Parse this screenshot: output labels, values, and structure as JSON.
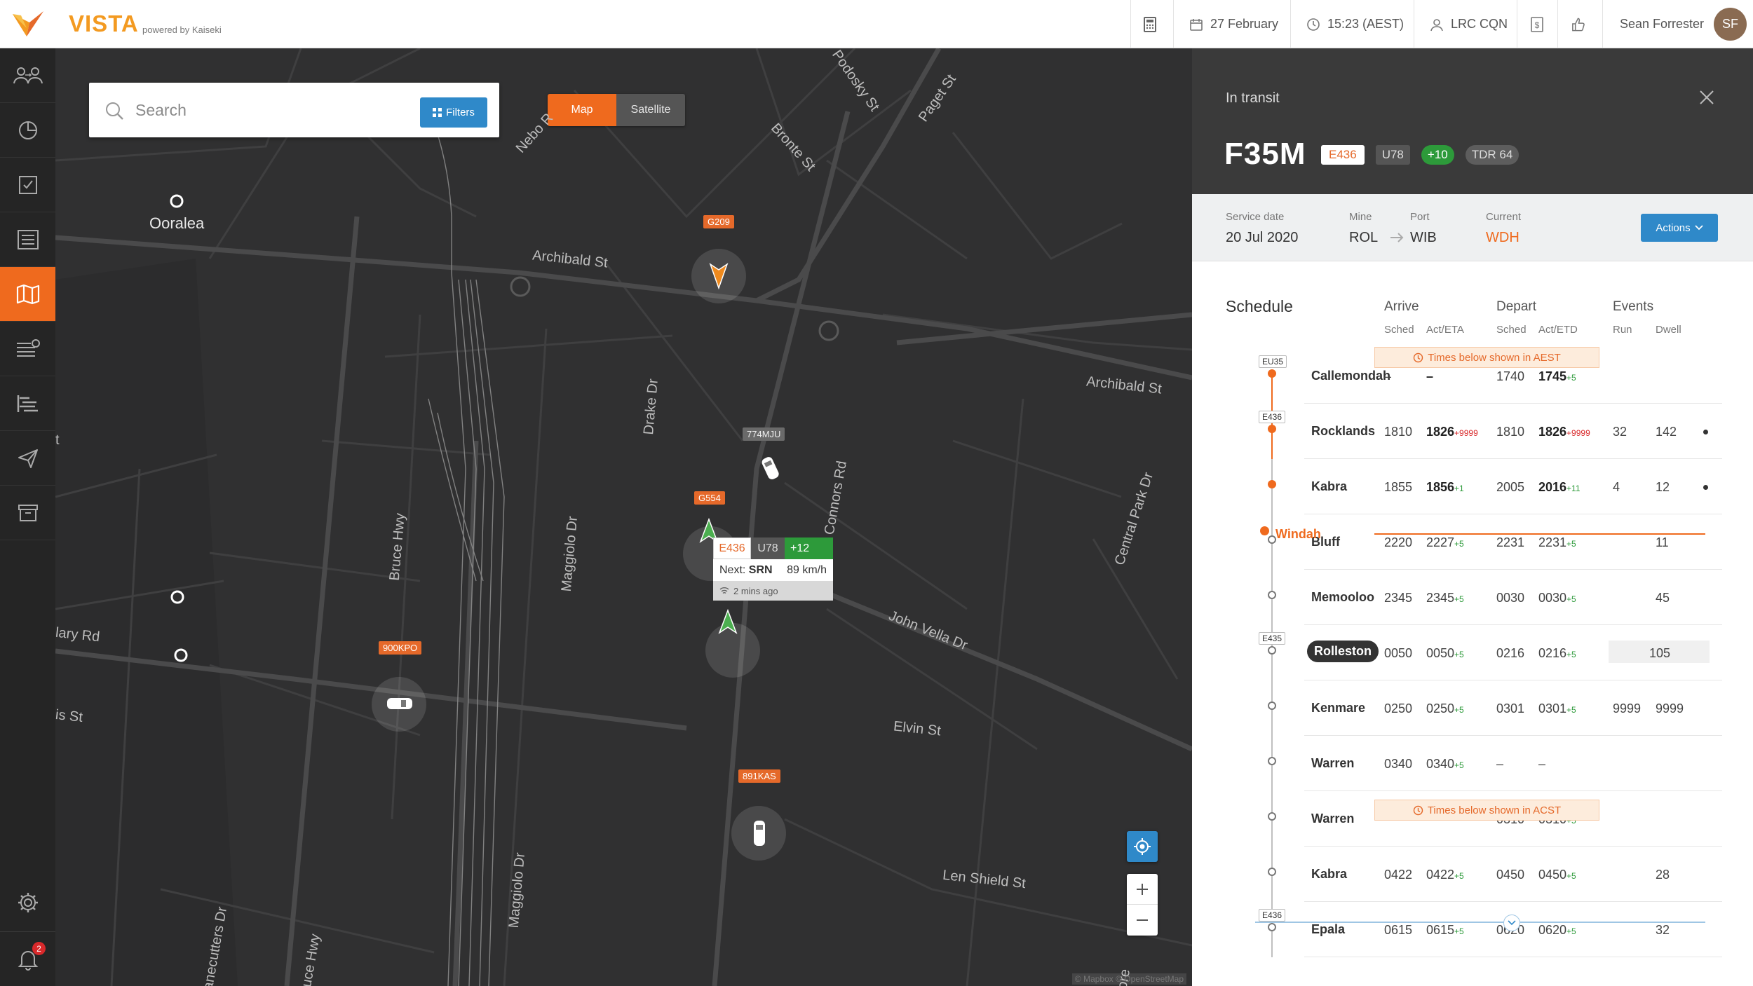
{
  "app": {
    "name": "VISTA",
    "powered_by": "powered by Kaiseki"
  },
  "topbar": {
    "date": "27 February",
    "time": "15:23 (AEST)",
    "location": "LRC CQN",
    "user_name": "Sean Forrester",
    "user_initials": "SF"
  },
  "leftnav": {
    "items": [
      "people-icon",
      "dashboard-icon",
      "checklist-icon",
      "schedule-icon",
      "map-icon",
      "list-clock-icon",
      "gantt-icon",
      "send-icon",
      "archive-icon"
    ],
    "active": "map-icon",
    "settings": "gear-icon",
    "notifications_count": "2"
  },
  "map": {
    "search_placeholder": "Search",
    "filters_label": "Filters",
    "view_map": "Map",
    "view_satellite": "Satellite",
    "streets": [
      "Archibald St",
      "Archibald St",
      "Bruce Hwy",
      "Bruce Hwy",
      "Maggiolo Dr",
      "Maggiolo Dr",
      "Drake Dr",
      "Connors Rd",
      "John Vella Dr",
      "Elvin St",
      "Len Shield St",
      "Central Park Dr",
      "Bronte St",
      "Podosky St",
      "Paget St",
      "Nebo R",
      "Canecutters Dr",
      "lary Rd",
      "is St",
      "t",
      "more"
    ],
    "place": "Ooralea",
    "vehicles": [
      "G209",
      "774MJU",
      "G554",
      "900KPO",
      "891KAS"
    ],
    "popup": {
      "train": "E436",
      "loco": "U78",
      "delta": "+12",
      "next_label": "Next:",
      "next_station": "SRN",
      "speed": "89 km/h",
      "last_seen": "2 mins ago"
    },
    "attribution": "© Mapbox © OpenStreetMap"
  },
  "panel": {
    "status": "In transit",
    "train_id": "F35M",
    "badges": [
      "E436",
      "U78",
      "+10",
      "TDR 64"
    ],
    "service_date_label": "Service date",
    "service_date": "20 Jul 2020",
    "mine_label": "Mine",
    "mine": "ROL",
    "port_label": "Port",
    "port": "WIB",
    "current_label": "Current",
    "current": "WDH",
    "actions_label": "Actions",
    "schedule_title": "Schedule",
    "col_arrive": "Arrive",
    "col_depart": "Depart",
    "col_events": "Events",
    "sub_sched": "Sched",
    "sub_act_eta": "Act/ETA",
    "sub_act_etd": "Act/ETD",
    "sub_run": "Run",
    "sub_dwell": "Dwell",
    "tz_aest": "Times below shown in AEST",
    "tz_acst": "Times below shown in ACST",
    "current_station": "Windah",
    "rows": [
      {
        "name": "Callemondah",
        "tag": "EU35",
        "arr_s": "–",
        "arr_a": "–",
        "arr_d": "",
        "dep_s": "1740",
        "dep_a": "1745",
        "dep_d": "+5",
        "run": "",
        "dwell": ""
      },
      {
        "name": "Rocklands",
        "tag": "E436",
        "arr_s": "1810",
        "arr_a": "1826",
        "arr_d": "+9999",
        "dep_s": "1810",
        "dep_a": "1826",
        "dep_d": "+9999",
        "run": "32",
        "dwell": "142"
      },
      {
        "name": "Kabra",
        "tag": "",
        "arr_s": "1855",
        "arr_a": "1856",
        "arr_d": "+1",
        "dep_s": "2005",
        "dep_a": "2016",
        "dep_d": "+11",
        "run": "4",
        "dwell": "12"
      },
      {
        "name": "Bluff",
        "tag": "",
        "arr_s": "2220",
        "arr_a": "2227",
        "arr_d": "+5",
        "dep_s": "2231",
        "dep_a": "2231",
        "dep_d": "+5",
        "run": "",
        "dwell": "11"
      },
      {
        "name": "Memooloo",
        "tag": "",
        "arr_s": "2345",
        "arr_a": "2345",
        "arr_d": "+5",
        "dep_s": "0030",
        "dep_a": "0030",
        "dep_d": "+5",
        "run": "",
        "dwell": "45"
      },
      {
        "name": "Rolleston",
        "tag": "E435",
        "arr_s": "0050",
        "arr_a": "0050",
        "arr_d": "+5",
        "dep_s": "0216",
        "dep_a": "0216",
        "dep_d": "+5",
        "run": "",
        "dwell": "105"
      },
      {
        "name": "Kenmare",
        "tag": "",
        "arr_s": "0250",
        "arr_a": "0250",
        "arr_d": "+5",
        "dep_s": "0301",
        "dep_a": "0301",
        "dep_d": "+5",
        "run": "9999",
        "dwell": "9999"
      },
      {
        "name": "Warren",
        "tag": "",
        "arr_s": "0340",
        "arr_a": "0340",
        "arr_d": "+5",
        "dep_s": "–",
        "dep_a": "–",
        "dep_d": "",
        "run": "",
        "dwell": ""
      },
      {
        "name": "Warren",
        "tag": "",
        "arr_s": "–",
        "arr_a": "–",
        "arr_d": "",
        "dep_s": "0310",
        "dep_a": "0310",
        "dep_d": "+5",
        "run": "",
        "dwell": ""
      },
      {
        "name": "Kabra",
        "tag": "",
        "arr_s": "0422",
        "arr_a": "0422",
        "arr_d": "+5",
        "dep_s": "0450",
        "dep_a": "0450",
        "dep_d": "+5",
        "run": "",
        "dwell": "28"
      },
      {
        "name": "Epala",
        "tag": "E436",
        "arr_s": "0615",
        "arr_a": "0615",
        "arr_d": "+5",
        "dep_s": "0620",
        "dep_a": "0620",
        "dep_d": "+5",
        "run": "",
        "dwell": "32"
      }
    ]
  },
  "colors": {
    "accent": "#ef6a1e",
    "blue": "#2f89c9",
    "green": "#2d9a3a",
    "dark": "#3a3a3a"
  }
}
